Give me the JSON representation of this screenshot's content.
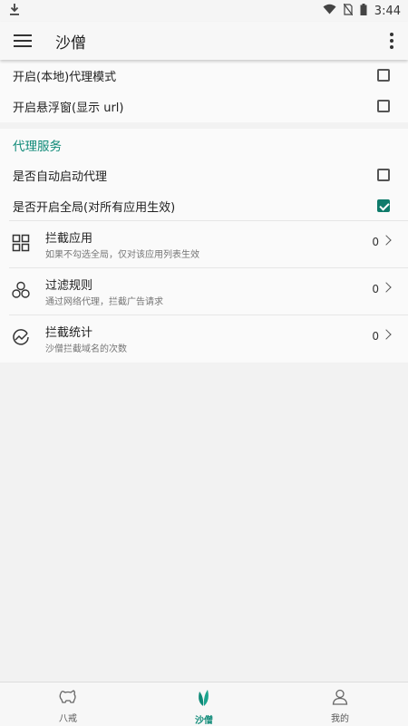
{
  "status_bar": {
    "time": "3:44"
  },
  "app_bar": {
    "title": "沙僧"
  },
  "settings_top": [
    {
      "label": "开启(本地)代理模式",
      "checked": false
    },
    {
      "label": "开启悬浮窗(显示 url)",
      "checked": false
    }
  ],
  "proxy_section": {
    "title": "代理服务",
    "toggles": [
      {
        "label": "是否自动启动代理",
        "checked": false
      },
      {
        "label": "是否开启全局(对所有应用生效)",
        "checked": true
      }
    ],
    "items": [
      {
        "icon": "grid-icon",
        "title": "拦截应用",
        "subtitle": "如果不勾选全局，仅对该应用列表生效",
        "count": "0"
      },
      {
        "icon": "hexagons-icon",
        "title": "过滤规则",
        "subtitle": "通过网络代理，拦截广告请求",
        "count": "0"
      },
      {
        "icon": "chart-icon",
        "title": "拦截统计",
        "subtitle": "沙僧拦截域名的次数",
        "count": "0"
      }
    ]
  },
  "bottom_nav": {
    "tabs": [
      {
        "label": "八戒",
        "icon": "pig-icon",
        "active": false
      },
      {
        "label": "沙僧",
        "icon": "leaf-icon",
        "active": true
      },
      {
        "label": "我的",
        "icon": "person-icon",
        "active": false
      }
    ]
  },
  "colors": {
    "accent": "#0f8a78",
    "checkbox_checked": "#0f7b6b"
  }
}
